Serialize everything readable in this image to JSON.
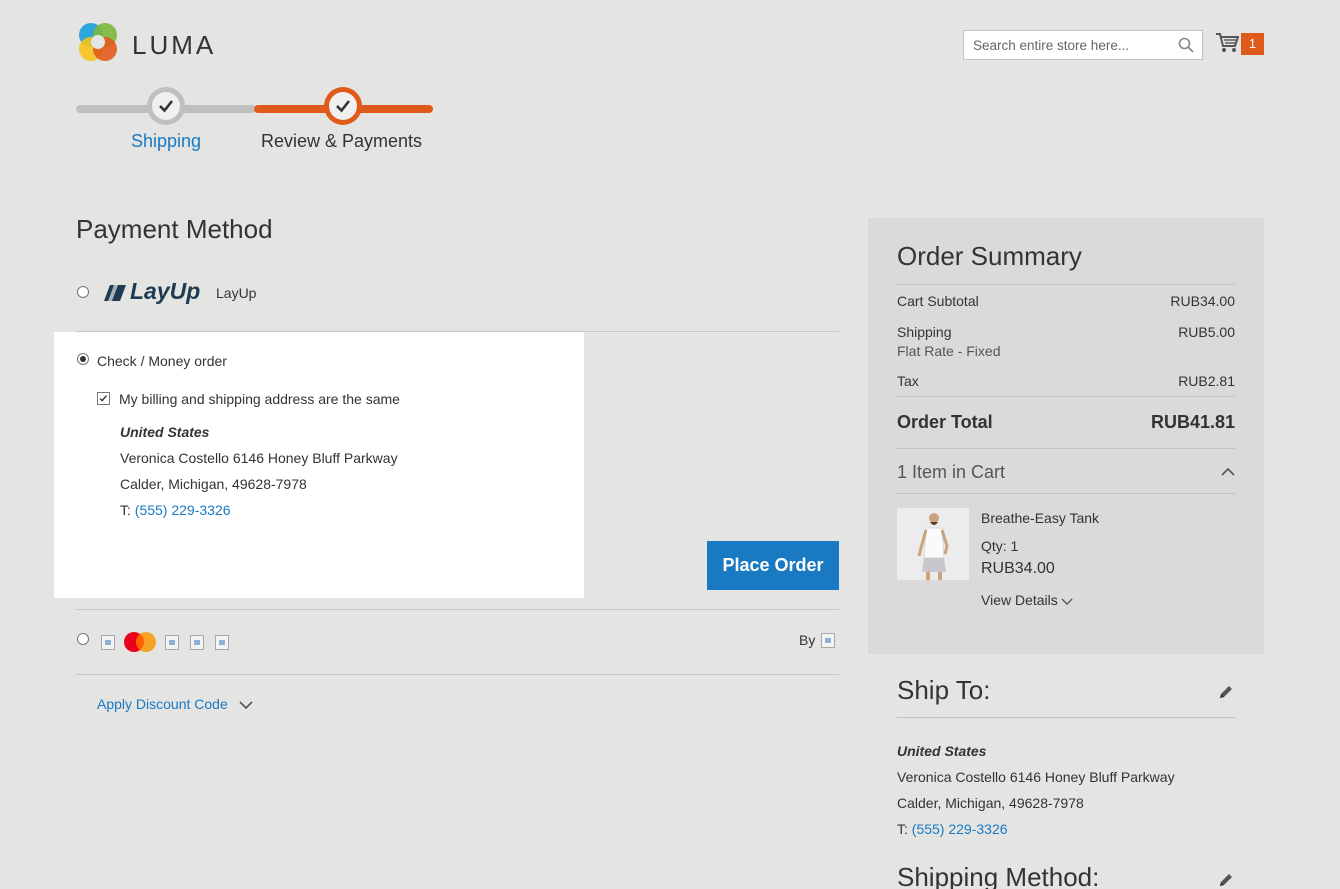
{
  "header": {
    "logo_text": "LUMA",
    "search_placeholder": "Search entire store here...",
    "cart_count": "1"
  },
  "progress": {
    "steps": [
      {
        "label": "Shipping",
        "state": "complete"
      },
      {
        "label": "Review & Payments",
        "state": "active"
      }
    ]
  },
  "payment": {
    "title": "Payment Method",
    "layup_logo_text": "LayUp",
    "layup_label": "LayUp",
    "check_label": "Check / Money order",
    "same_address_label": "My billing and shipping address are the same",
    "address": {
      "country": "United States",
      "line1": "Veronica Costello 6146 Honey Bluff Parkway",
      "line2": "Calder, Michigan, 49628-7978",
      "phone_prefix": "T: ",
      "phone": "(555) 229-3326"
    },
    "place_order_label": "Place Order",
    "card_by_label": "By",
    "discount_label": "Apply Discount Code"
  },
  "summary": {
    "title": "Order Summary",
    "rows": {
      "subtotal_label": "Cart Subtotal",
      "subtotal_value": "RUB34.00",
      "shipping_label": "Shipping",
      "shipping_value": "RUB5.00",
      "shipping_method": "Flat Rate - Fixed",
      "tax_label": "Tax",
      "tax_value": "RUB2.81",
      "total_label": "Order Total",
      "total_value": "RUB41.81"
    },
    "items_in_cart": "1 Item in Cart",
    "item": {
      "name": "Breathe-Easy Tank",
      "qty": "Qty: 1",
      "price": "RUB34.00",
      "details_label": "View Details"
    }
  },
  "ship_to": {
    "title": "Ship To:",
    "country": "United States",
    "line1": "Veronica Costello 6146 Honey Bluff Parkway",
    "line2": "Calder, Michigan, 49628-7978",
    "phone_prefix": "T: ",
    "phone": "(555) 229-3326"
  },
  "shipping_method": {
    "title": "Shipping Method:"
  },
  "colors": {
    "accent": "#e05a1c",
    "link": "#1979c3",
    "button": "#1979c3"
  }
}
